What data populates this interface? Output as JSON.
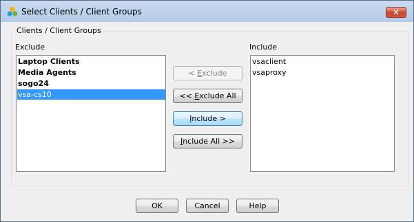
{
  "window": {
    "title": "Select Clients / Client Groups",
    "close_glyph": "✕"
  },
  "group": {
    "label": "Clients / Client Groups"
  },
  "exclude": {
    "label": "Exclude",
    "items": [
      {
        "text": "Laptop Clients",
        "bold": true,
        "selected": false
      },
      {
        "text": "Media Agents",
        "bold": true,
        "selected": false
      },
      {
        "text": "sogo24",
        "bold": true,
        "selected": false
      },
      {
        "text": "vsa-cs10",
        "bold": false,
        "selected": true
      }
    ]
  },
  "include": {
    "label": "Include",
    "items": [
      {
        "text": "vsaclient"
      },
      {
        "text": "vsaproxy"
      }
    ]
  },
  "buttons": {
    "exclude": {
      "pre": "< ",
      "key": "E",
      "rest": "xclude",
      "disabled": true
    },
    "exclude_all": {
      "pre": "<< ",
      "key": "E",
      "rest": "xclude All",
      "disabled": false
    },
    "include": {
      "pre": "",
      "key": "I",
      "rest": "nclude >",
      "disabled": false,
      "focused": true
    },
    "include_all": {
      "pre": "",
      "key": "I",
      "rest": "nclude All >>",
      "disabled": false
    }
  },
  "footer": {
    "ok": "OK",
    "cancel": "Cancel",
    "help": "Help"
  },
  "colors": {
    "selection": "#3399ff",
    "title_gradient_top": "#c9daf0",
    "close_red": "#c7452c",
    "focus_border": "#3c7fb1"
  }
}
